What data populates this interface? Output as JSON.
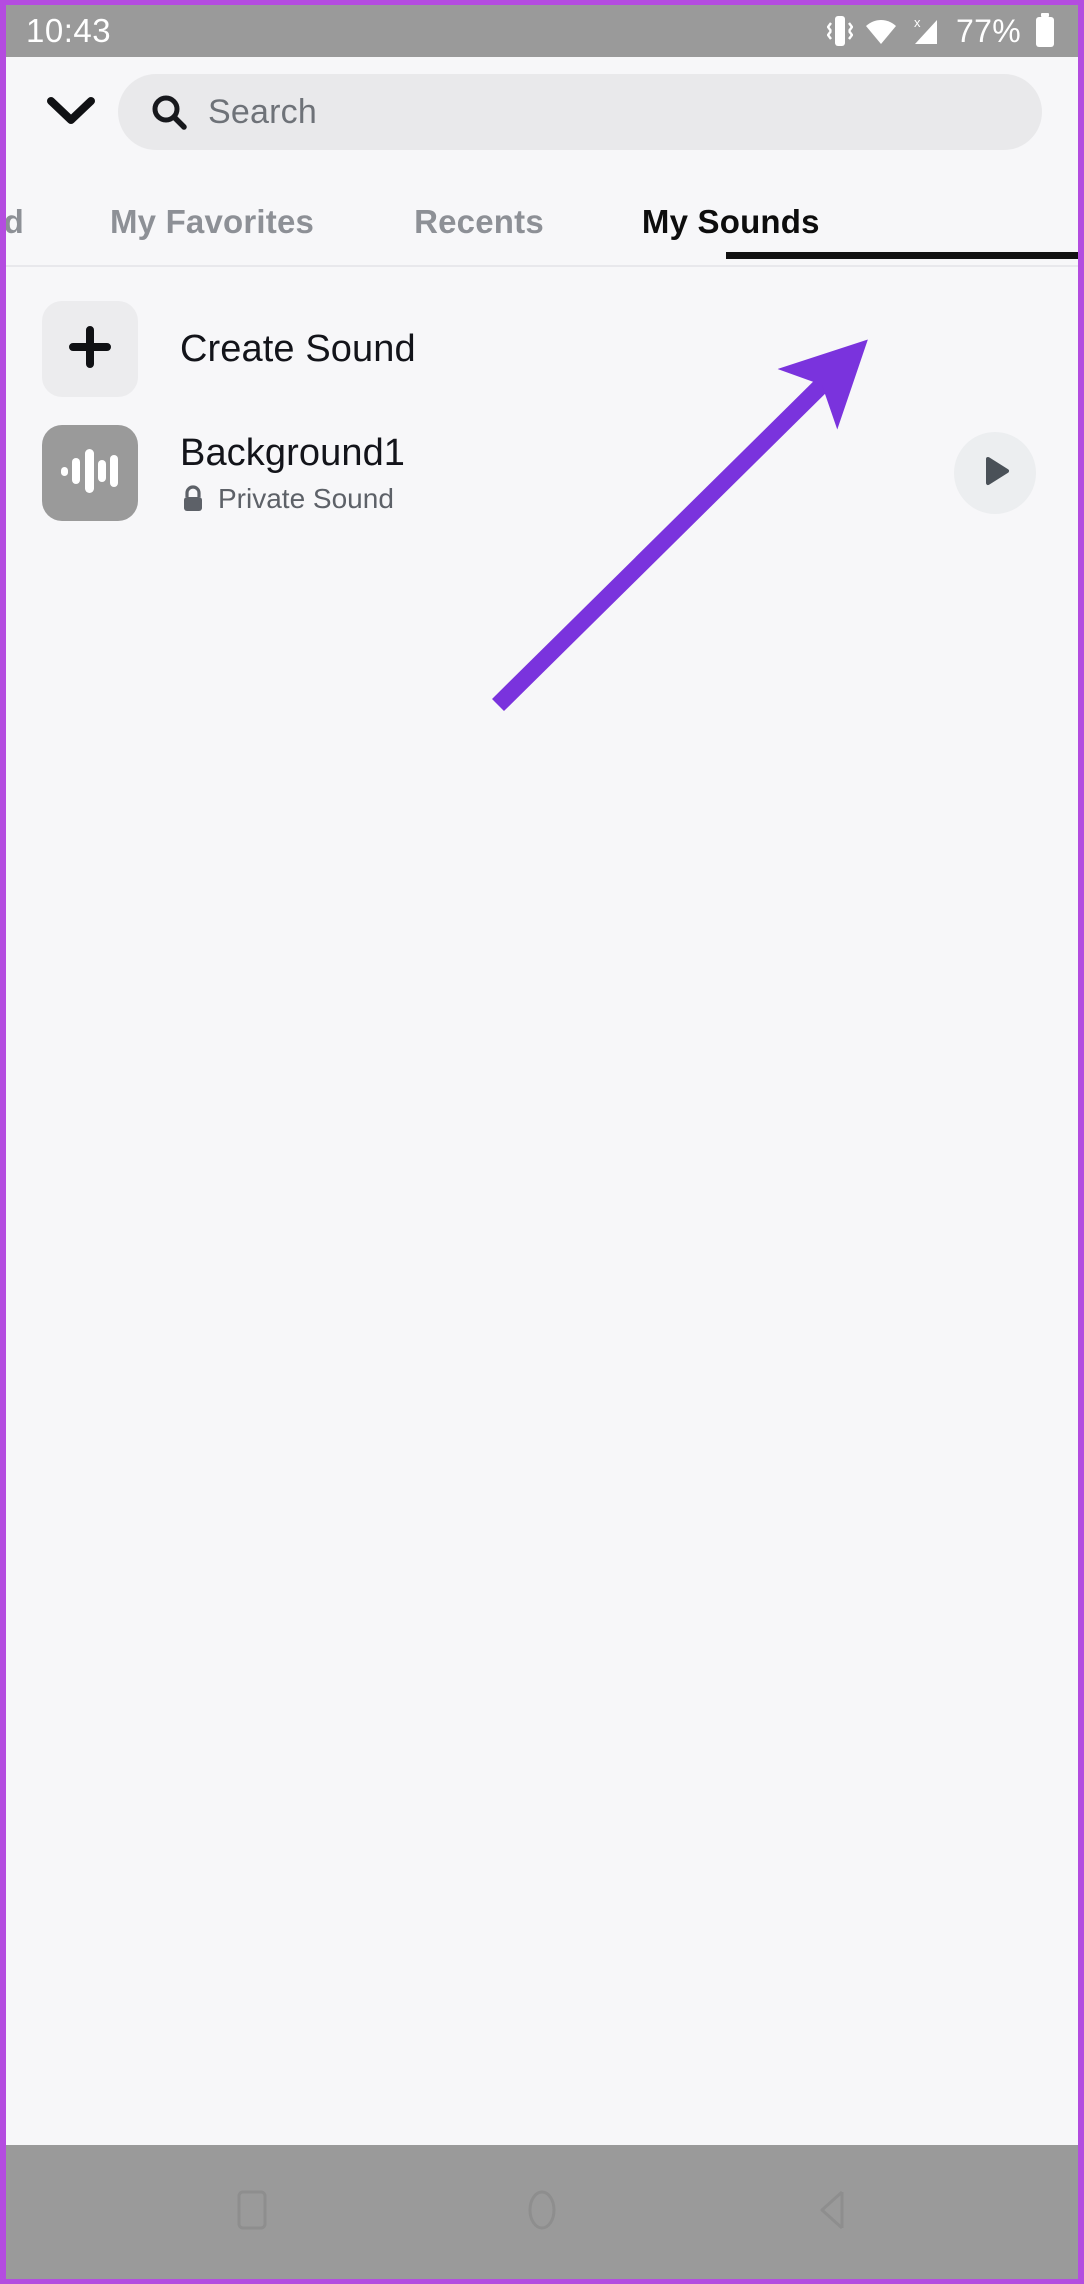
{
  "status_bar": {
    "time": "10:43",
    "battery_percent": "77%",
    "icons": [
      "vibrate-icon",
      "wifi-icon",
      "cellular-signal-no-service-icon",
      "battery-icon"
    ]
  },
  "header": {
    "collapse_label": "chevron-down-icon",
    "search": {
      "placeholder": "Search",
      "value": "",
      "icon": "search-icon"
    }
  },
  "tabs": [
    {
      "label": "red",
      "active": false
    },
    {
      "label": "My Favorites",
      "active": false
    },
    {
      "label": "Recents",
      "active": false
    },
    {
      "label": "My Sounds",
      "active": true
    }
  ],
  "list": [
    {
      "title": "Create Sound",
      "subtitle": "",
      "icon": "plus-icon",
      "thumb_style": "light",
      "has_play": false
    },
    {
      "title": "Background1",
      "subtitle": "Private Sound",
      "subtitle_icon": "lock-icon",
      "icon": "waveform-icon",
      "thumb_style": "gray",
      "has_play": true,
      "play_label": "play-icon"
    }
  ],
  "annotation": {
    "type": "arrow",
    "color": "#7a33dd",
    "points": "from (490,700) to (845,352)"
  },
  "nav_bar": {
    "buttons": [
      "recents-square-icon",
      "home-circle-icon",
      "back-triangle-icon"
    ]
  },
  "colors": {
    "accent_purple": "#b44ce0",
    "annotation_purple": "#7a33dd",
    "status_bar_gray": "#9a9a9a",
    "page_bg": "#f7f7f9",
    "active_tab": "#0d0d0d",
    "inactive_tab": "#8d9096"
  }
}
